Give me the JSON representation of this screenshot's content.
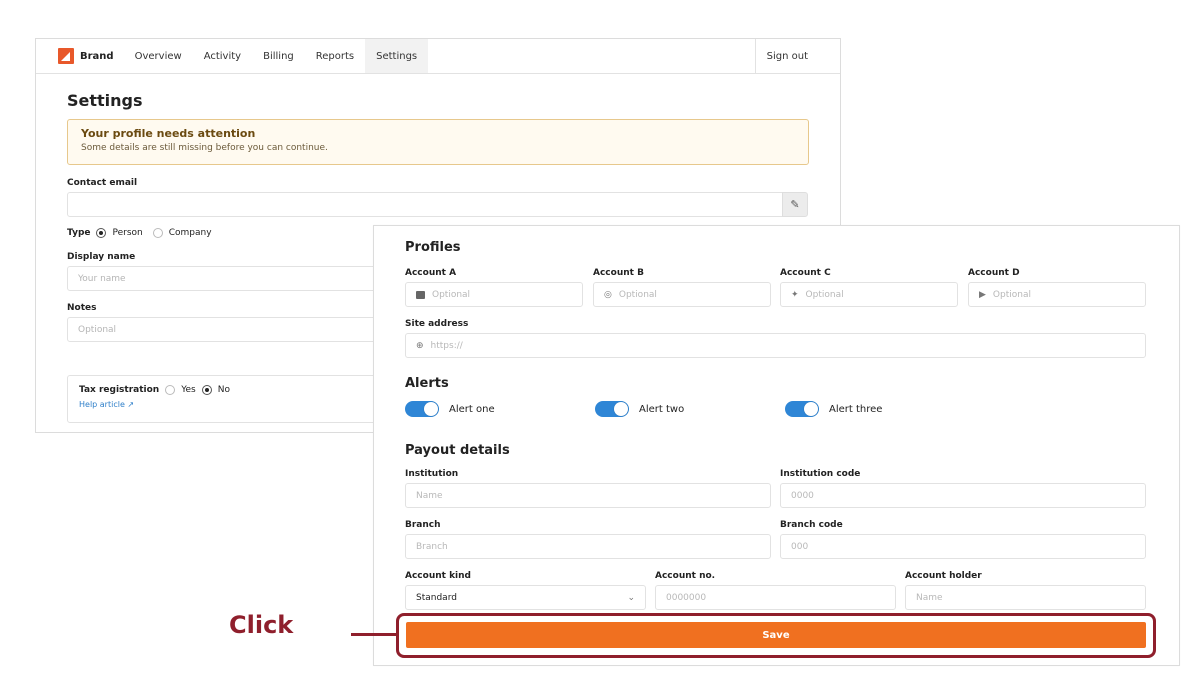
{
  "nav": {
    "brand": "Brand",
    "items": [
      "Overview",
      "Activity",
      "Billing",
      "Reports",
      "Settings"
    ],
    "logout": "Sign out"
  },
  "settings": {
    "title": "Settings",
    "alert_title": "Your profile needs attention",
    "alert_body": "Some details are still missing before you can continue.",
    "email_label": "Contact email",
    "category_label": "Type",
    "category_options": [
      "Person",
      "Company"
    ],
    "name_label": "Display name",
    "name_placeholder": "Your name",
    "notes_label": "Notes",
    "notes_placeholder": "Optional",
    "invoice_label": "Tax registration",
    "invoice_options": [
      "Yes",
      "No"
    ],
    "manual_link": "Help article ↗"
  },
  "media": {
    "title": "Profiles",
    "fields": [
      {
        "label": "Account A",
        "placeholder": "Optional",
        "icon": "square-icon"
      },
      {
        "label": "Account B",
        "placeholder": "Optional",
        "icon": "circle-icon"
      },
      {
        "label": "Account C",
        "placeholder": "Optional",
        "icon": "bird-icon"
      },
      {
        "label": "Account D",
        "placeholder": "Optional",
        "icon": "play-icon"
      }
    ],
    "website_label": "Site address",
    "website_placeholder": "https://"
  },
  "notifications": {
    "title": "Alerts",
    "items": [
      "Alert one",
      "Alert two",
      "Alert three"
    ]
  },
  "bank": {
    "title": "Payout details",
    "bank_name_label": "Institution",
    "bank_name_placeholder": "Name",
    "bank_code_label": "Institution code",
    "bank_code_placeholder": "0000",
    "branch_label": "Branch",
    "branch_placeholder": "Branch",
    "branch_code_label": "Branch code",
    "branch_code_placeholder": "000",
    "type_label": "Account kind",
    "type_value": "Standard",
    "number_label": "Account no.",
    "number_placeholder": "0000000",
    "holder_label": "Account holder",
    "holder_placeholder": "Name"
  },
  "save_label": "Save",
  "annotation": "Click",
  "colors": {
    "accent": "#f07020",
    "toggle": "#2f86d6",
    "highlight": "#8f1f2c"
  }
}
